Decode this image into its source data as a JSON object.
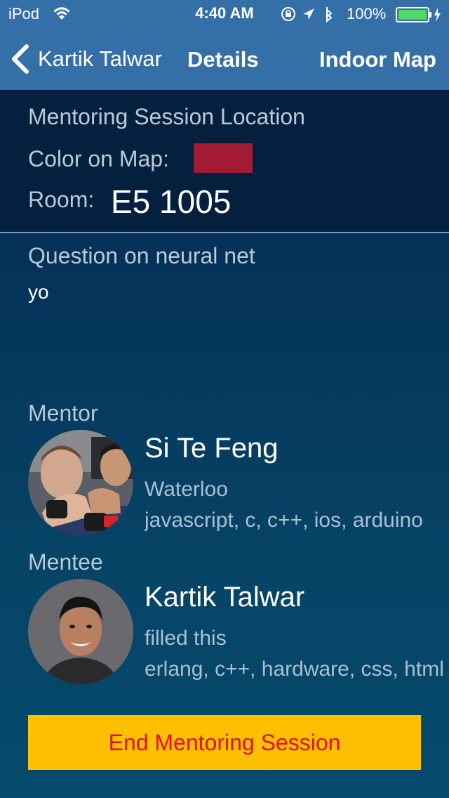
{
  "status_bar": {
    "carrier": "iPod",
    "time": "4:40 AM",
    "battery_percent": "100%",
    "icons": [
      "wifi-icon",
      "rotation-lock-icon",
      "location-arrow-icon",
      "bluetooth-icon",
      "battery-icon",
      "charging-bolt-icon"
    ]
  },
  "nav": {
    "back_label": "Kartik Talwar",
    "title": "Details",
    "right_label": "Indoor Map"
  },
  "location": {
    "heading": "Mentoring Session Location",
    "color_label": "Color on Map:",
    "map_color": "#a31b33",
    "room_label": "Room:",
    "room_value": "E5 1005"
  },
  "question": {
    "title": "Question on neural net",
    "body": "yo"
  },
  "mentor": {
    "section_label": "Mentor",
    "name": "Si Te Feng",
    "school": "Waterloo",
    "skills": "javascript, c, c++, ios, arduino"
  },
  "mentee": {
    "section_label": "Mentee",
    "name": "Kartik Talwar",
    "school": "filled this",
    "skills": "erlang, c++, hardware, css, html"
  },
  "actions": {
    "end_session_label": "End Mentoring Session"
  },
  "colors": {
    "nav_bar": "#356fa8",
    "button_bg": "#fec000",
    "button_text": "#e0101b"
  }
}
